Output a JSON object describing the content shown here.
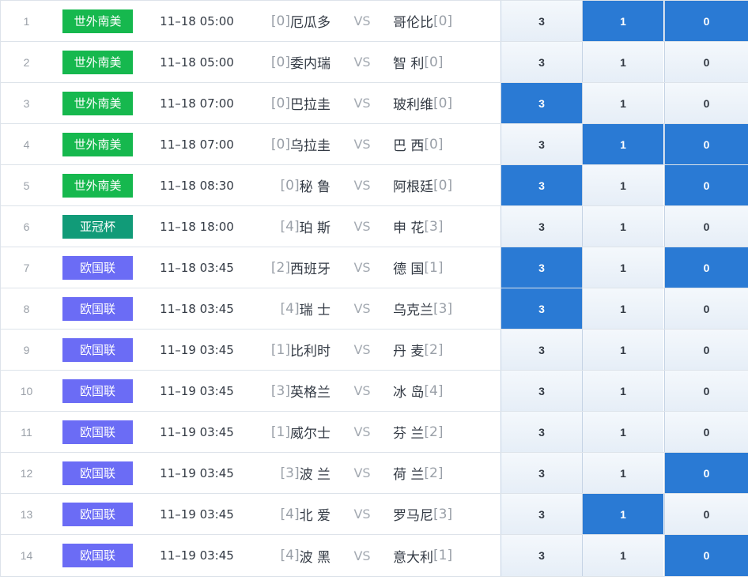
{
  "leagues": {
    "world_sa": {
      "label": "世外南美",
      "color": "#16b84e"
    },
    "afc": {
      "label": "亚冠杯",
      "color": "#119b78"
    },
    "uefa": {
      "label": "欧国联",
      "color": "#6b6cf5"
    }
  },
  "options_labels": {
    "win": "3",
    "draw": "1",
    "lose": "0"
  },
  "vs_label": "VS",
  "selected_color": "#2a7ad4",
  "matches": [
    {
      "no": "1",
      "league": "world_sa",
      "time": "11–18 05:00",
      "home_rank": "[0]",
      "home": "厄瓜多",
      "away": "哥伦比",
      "away_rank": "[0]",
      "selected": {
        "win": false,
        "draw": true,
        "lose": true
      }
    },
    {
      "no": "2",
      "league": "world_sa",
      "time": "11–18 05:00",
      "home_rank": "[0]",
      "home": "委内瑞",
      "away": "智 利",
      "away_rank": "[0]",
      "selected": {
        "win": false,
        "draw": false,
        "lose": false
      }
    },
    {
      "no": "3",
      "league": "world_sa",
      "time": "11–18 07:00",
      "home_rank": "[0]",
      "home": "巴拉圭",
      "away": "玻利维",
      "away_rank": "[0]",
      "selected": {
        "win": true,
        "draw": false,
        "lose": false
      }
    },
    {
      "no": "4",
      "league": "world_sa",
      "time": "11–18 07:00",
      "home_rank": "[0]",
      "home": "乌拉圭",
      "away": "巴 西",
      "away_rank": "[0]",
      "selected": {
        "win": false,
        "draw": true,
        "lose": true
      }
    },
    {
      "no": "5",
      "league": "world_sa",
      "time": "11–18 08:30",
      "home_rank": "[0]",
      "home": "秘 鲁",
      "away": "阿根廷",
      "away_rank": "[0]",
      "selected": {
        "win": true,
        "draw": false,
        "lose": true
      }
    },
    {
      "no": "6",
      "league": "afc",
      "time": "11–18 18:00",
      "home_rank": "[4]",
      "home": "珀 斯",
      "away": "申 花",
      "away_rank": "[3]",
      "selected": {
        "win": false,
        "draw": false,
        "lose": false
      }
    },
    {
      "no": "7",
      "league": "uefa",
      "time": "11–18 03:45",
      "home_rank": "[2]",
      "home": "西班牙",
      "away": "德 国",
      "away_rank": "[1]",
      "selected": {
        "win": true,
        "draw": false,
        "lose": true
      }
    },
    {
      "no": "8",
      "league": "uefa",
      "time": "11–18 03:45",
      "home_rank": "[4]",
      "home": "瑞 士",
      "away": "乌克兰",
      "away_rank": "[3]",
      "selected": {
        "win": true,
        "draw": false,
        "lose": false
      }
    },
    {
      "no": "9",
      "league": "uefa",
      "time": "11–19 03:45",
      "home_rank": "[1]",
      "home": "比利时",
      "away": "丹 麦",
      "away_rank": "[2]",
      "selected": {
        "win": false,
        "draw": false,
        "lose": false
      }
    },
    {
      "no": "10",
      "league": "uefa",
      "time": "11–19 03:45",
      "home_rank": "[3]",
      "home": "英格兰",
      "away": "冰 岛",
      "away_rank": "[4]",
      "selected": {
        "win": false,
        "draw": false,
        "lose": false
      }
    },
    {
      "no": "11",
      "league": "uefa",
      "time": "11–19 03:45",
      "home_rank": "[1]",
      "home": "威尔士",
      "away": "芬 兰",
      "away_rank": "[2]",
      "selected": {
        "win": false,
        "draw": false,
        "lose": false
      }
    },
    {
      "no": "12",
      "league": "uefa",
      "time": "11–19 03:45",
      "home_rank": "[3]",
      "home": "波 兰",
      "away": "荷 兰",
      "away_rank": "[2]",
      "selected": {
        "win": false,
        "draw": false,
        "lose": true
      }
    },
    {
      "no": "13",
      "league": "uefa",
      "time": "11–19 03:45",
      "home_rank": "[4]",
      "home": "北 爱",
      "away": "罗马尼",
      "away_rank": "[3]",
      "selected": {
        "win": false,
        "draw": true,
        "lose": false
      }
    },
    {
      "no": "14",
      "league": "uefa",
      "time": "11–19 03:45",
      "home_rank": "[4]",
      "home": "波 黑",
      "away": "意大利",
      "away_rank": "[1]",
      "selected": {
        "win": false,
        "draw": false,
        "lose": true
      }
    }
  ]
}
